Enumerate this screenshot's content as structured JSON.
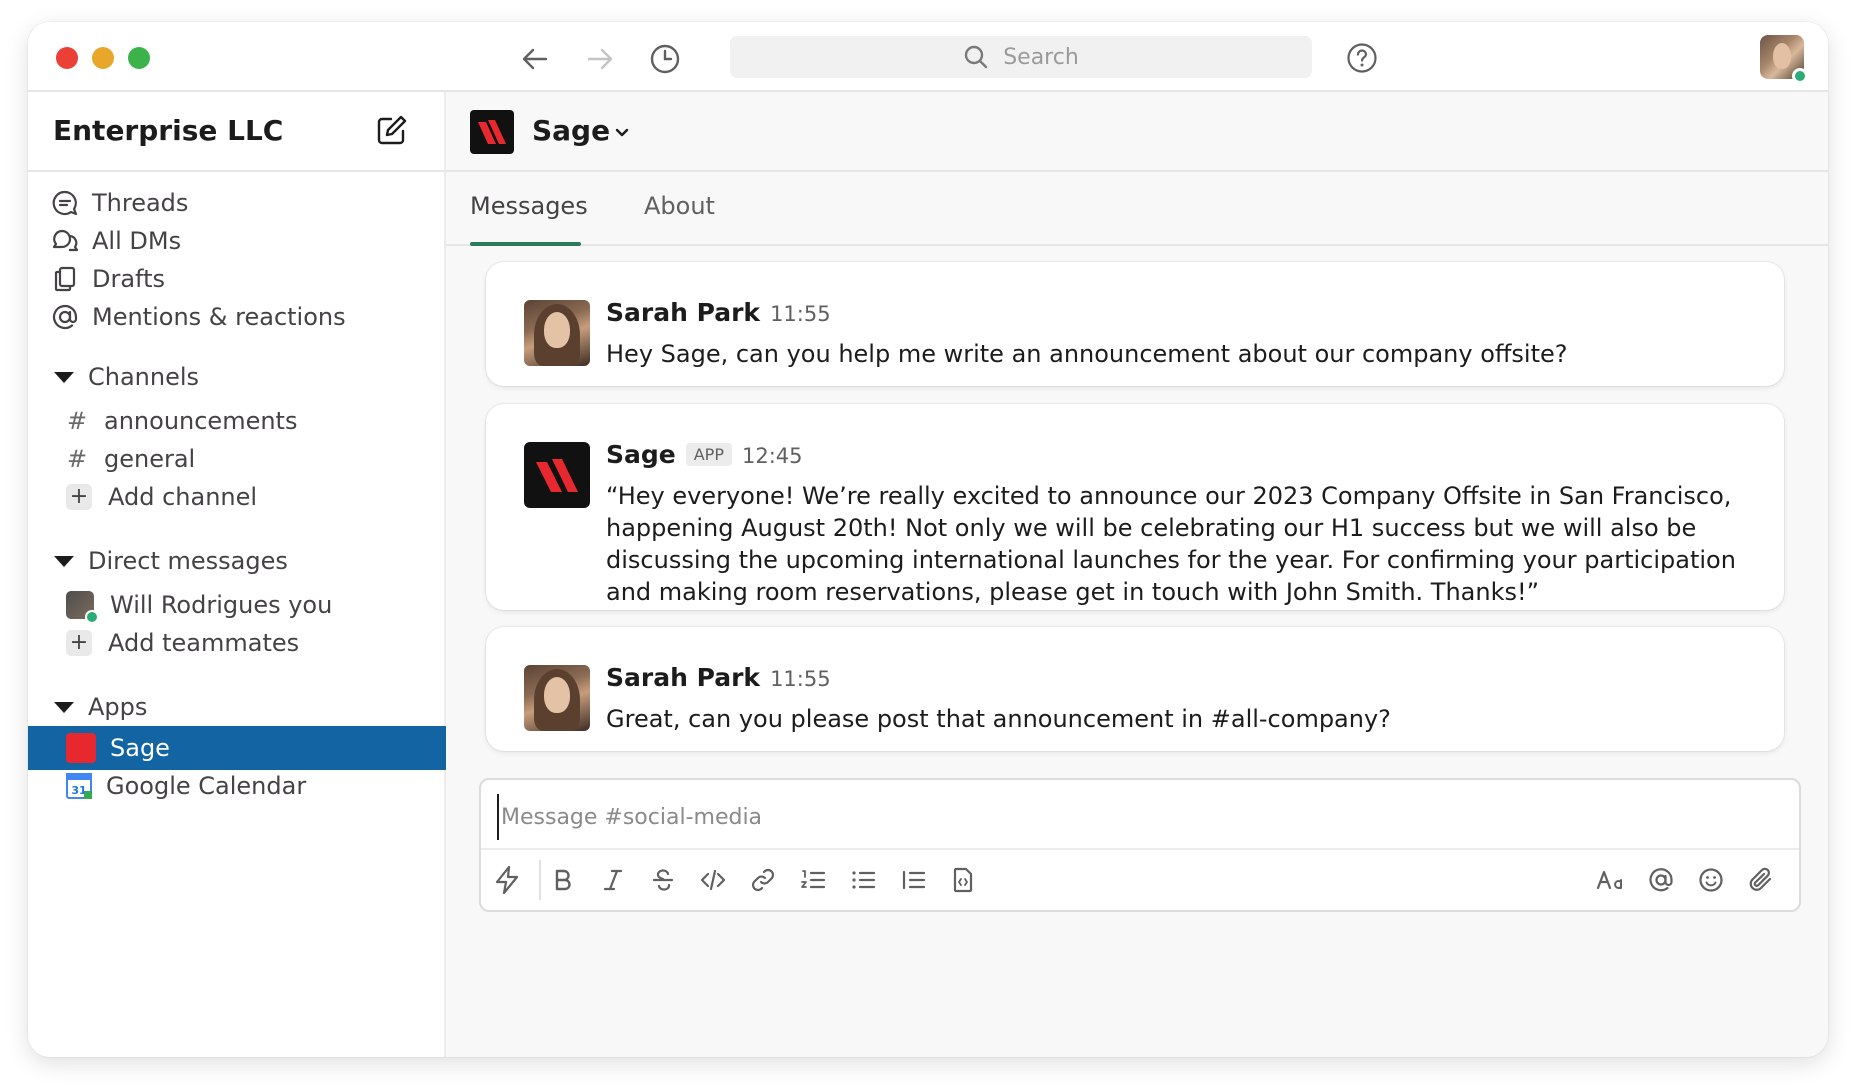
{
  "window": {
    "colors": {
      "close": "#ec3f36",
      "minimize": "#e8a62a",
      "maximize": "#3bb34a",
      "selected": "#1264a3",
      "tab_accent": "#2c7a5c",
      "sage_brand": "#e8282f",
      "online": "#2bac76"
    }
  },
  "topbar": {
    "back_icon": "arrow-left-icon",
    "forward_icon": "arrow-right-icon",
    "history_icon": "clock-icon",
    "search_placeholder": "Search",
    "help_icon": "question-circle-icon"
  },
  "sidebar": {
    "workspace_name": "Enterprise LLC",
    "nav": [
      {
        "label": "Threads",
        "icon": "threads-icon"
      },
      {
        "label": "All DMs",
        "icon": "dms-icon"
      },
      {
        "label": "Drafts",
        "icon": "drafts-icon"
      },
      {
        "label": "Mentions & reactions",
        "icon": "at-icon"
      }
    ],
    "channels": {
      "title": "Channels",
      "items": [
        {
          "prefix": "#",
          "label": "announcements"
        },
        {
          "prefix": "#",
          "label": "general"
        }
      ],
      "add_label": "Add channel"
    },
    "dms": {
      "title": "Direct messages",
      "items": [
        {
          "label": "Will Rodrigues you"
        }
      ],
      "add_label": "Add teammates"
    },
    "apps": {
      "title": "Apps",
      "items": [
        {
          "label": "Sage",
          "selected": true
        },
        {
          "label": "Google Calendar",
          "icon_text": "31"
        }
      ]
    }
  },
  "channel": {
    "title": "Sage",
    "tabs": [
      {
        "label": "Messages",
        "active": true
      },
      {
        "label": "About",
        "active": false
      }
    ]
  },
  "messages": [
    {
      "author": "Sarah Park",
      "time": "11:55",
      "text": "Hey Sage, can you help me write an announcement about our company offsite?"
    },
    {
      "author": "Sage",
      "badge": "APP",
      "time": "12:45",
      "text": "“Hey everyone! We’re really excited to announce our 2023 Company Offsite in San Francisco, happening August 20th! Not only we will be celebrating our H1 success but we will also be discussing the upcoming international launches for the year. For confirming your participation and making room reservations, please get in touch with John Smith. Thanks!”"
    },
    {
      "author": "Sarah Park",
      "time": "11:55",
      "text": "Great, can you please post that announcement in #all-company?"
    }
  ],
  "composer": {
    "placeholder": "Message #social-media",
    "tools_left": [
      "shortcuts-icon",
      "bold-icon",
      "italic-icon",
      "strikethrough-icon",
      "code-icon",
      "link-icon",
      "ordered-list-icon",
      "bullet-list-icon",
      "blockquote-icon",
      "code-block-icon"
    ],
    "tools_right": [
      "formatting-icon",
      "mention-icon",
      "emoji-icon",
      "attach-icon"
    ]
  }
}
